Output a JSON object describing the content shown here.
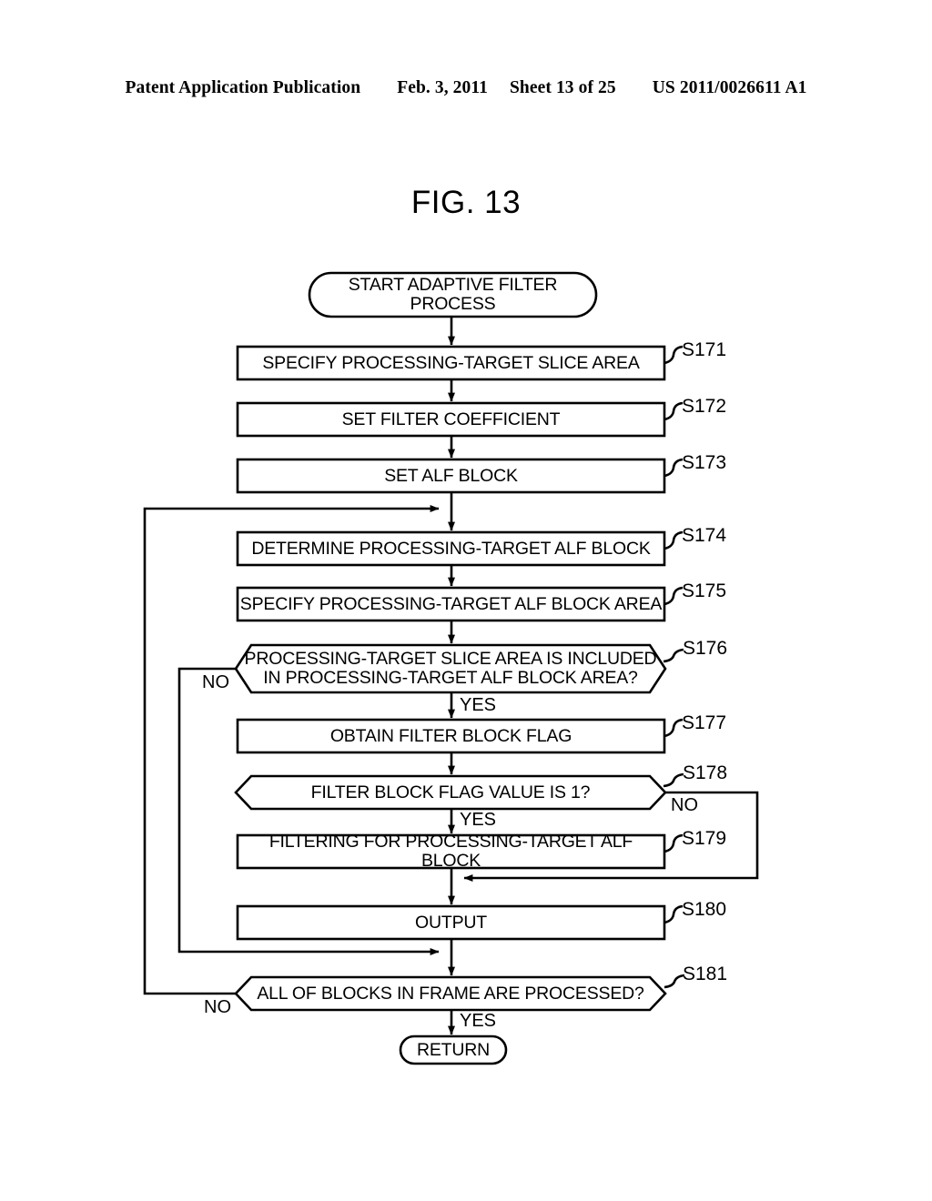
{
  "header": {
    "publication": "Patent Application Publication",
    "date": "Feb. 3, 2011",
    "sheet": "Sheet 13 of 25",
    "number": "US 2011/0026611 A1"
  },
  "figure": {
    "title": "FIG. 13"
  },
  "flowchart": {
    "ink_color": "#000000",
    "background": "#ffffff",
    "nodes": [
      {
        "id": "start",
        "type": "terminal",
        "text": "START ADAPTIVE FILTER\nPROCESS",
        "step": ""
      },
      {
        "id": "s171",
        "type": "process",
        "text": "SPECIFY PROCESSING-TARGET SLICE AREA",
        "step": "S171"
      },
      {
        "id": "s172",
        "type": "process",
        "text": "SET FILTER COEFFICIENT",
        "step": "S172"
      },
      {
        "id": "s173",
        "type": "process",
        "text": "SET ALF BLOCK",
        "step": "S173"
      },
      {
        "id": "s174",
        "type": "process",
        "text": "DETERMINE PROCESSING-TARGET ALF BLOCK",
        "step": "S174"
      },
      {
        "id": "s175",
        "type": "process",
        "text": "SPECIFY PROCESSING-TARGET ALF BLOCK AREA",
        "step": "S175"
      },
      {
        "id": "s176",
        "type": "decision",
        "text": "PROCESSING-TARGET SLICE AREA IS INCLUDED\nIN PROCESSING-TARGET ALF BLOCK AREA?",
        "step": "S176"
      },
      {
        "id": "s177",
        "type": "process",
        "text": "OBTAIN FILTER BLOCK FLAG",
        "step": "S177"
      },
      {
        "id": "s178",
        "type": "decision",
        "text": "FILTER BLOCK FLAG VALUE IS 1?",
        "step": "S178"
      },
      {
        "id": "s179",
        "type": "process",
        "text": "FILTERING FOR PROCESSING-TARGET ALF BLOCK",
        "step": "S179"
      },
      {
        "id": "s180",
        "type": "process",
        "text": "OUTPUT",
        "step": "S180"
      },
      {
        "id": "s181",
        "type": "decision",
        "text": "ALL OF BLOCKS IN FRAME ARE PROCESSED?",
        "step": "S181"
      },
      {
        "id": "return",
        "type": "terminal",
        "text": "RETURN",
        "step": ""
      }
    ],
    "edge_labels": [
      {
        "id": "s176-no",
        "text": "NO",
        "from": "s176",
        "branch": "no"
      },
      {
        "id": "s176-yes",
        "text": "YES",
        "from": "s176",
        "branch": "yes"
      },
      {
        "id": "s178-no",
        "text": "NO",
        "from": "s178",
        "branch": "no"
      },
      {
        "id": "s178-yes",
        "text": "YES",
        "from": "s178",
        "branch": "yes"
      },
      {
        "id": "s181-no",
        "text": "NO",
        "from": "s181",
        "branch": "no"
      },
      {
        "id": "s181-yes",
        "text": "YES",
        "from": "s181",
        "branch": "yes"
      }
    ]
  }
}
